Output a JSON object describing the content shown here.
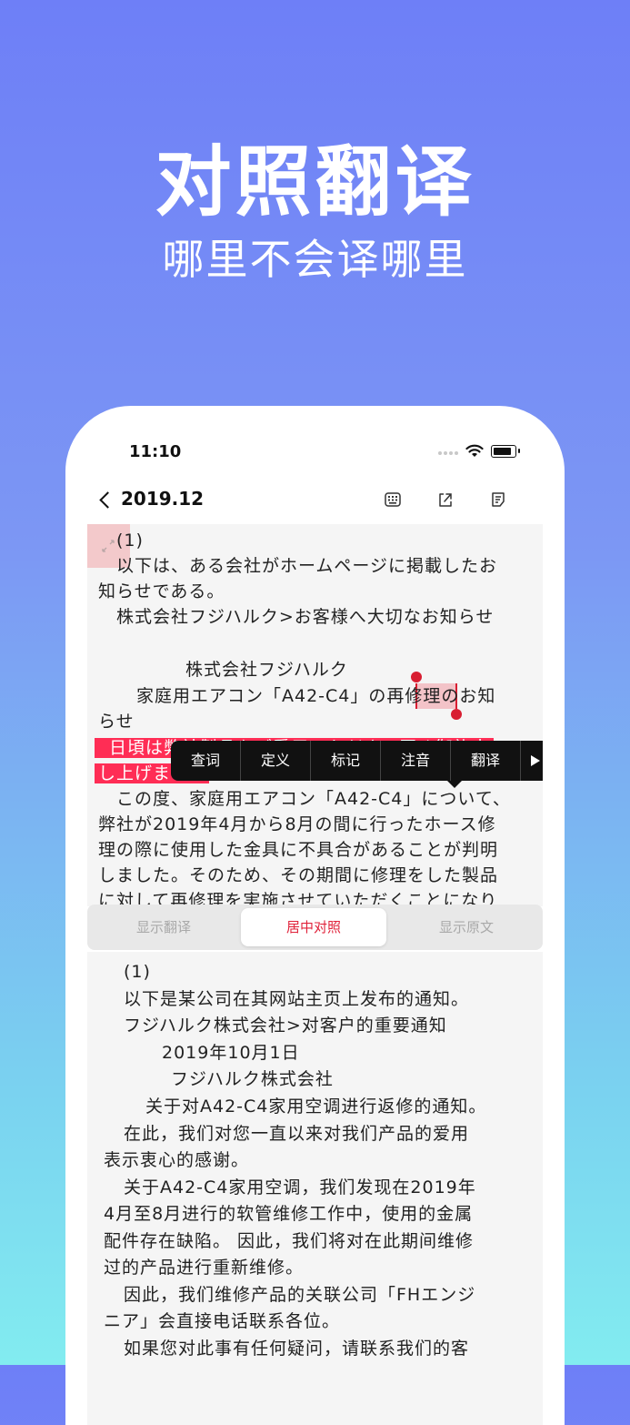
{
  "hero": {
    "title": "对照翻译",
    "subtitle": "哪里不会译哪里"
  },
  "status": {
    "time": "11:10"
  },
  "nav": {
    "back_label": "2019.12",
    "icons": [
      "keyboard-icon",
      "share-icon",
      "note-icon"
    ]
  },
  "original": {
    "lines": [
      "(1)",
      "以下は、ある会社がホームページに掲載したお",
      "知らせである。",
      "株式会社フジハルク>お客様へ大切なお知らせ",
      "株式会社フジハルク",
      "家庭用エアコン「A42-C4」の再修理のお知",
      "らせ",
      "日頃は弊社製品をご愛用いただき、厚く御礼申",
      "し上げます。",
      "この度、家庭用エアコン「A42-C4」について、",
      "弊社が2019年4月から8月の間に行ったホース修",
      "理の際に使用した金具に不具合があることが判明",
      "しました。そのため、その期間に修理をした製品",
      "に対して再修理を実施させていただくことになり"
    ]
  },
  "popup_menu": {
    "items": [
      "查词",
      "定义",
      "标记",
      "注音",
      "翻译"
    ]
  },
  "segments": {
    "options": [
      "显示翻译",
      "居中对照",
      "显示原文"
    ],
    "selected": "居中对照"
  },
  "translation": {
    "lines": [
      "(1)",
      "以下是某公司在其网站主页上发布的通知。",
      "フジハルク株式会社>对客户的重要通知",
      "2019年10月1日",
      "フジハルク株式会社",
      "关于对A42-C4家用空调进行返修的通知。",
      "在此，我们对您一直以来对我们产品的爱用",
      "表示衷心的感谢。",
      "关于A42-C4家用空调，我们发现在2019年",
      "4月至8月进行的软管维修工作中，使用的金属",
      "配件存在缺陷。 因此，我们将对在此期间维修",
      "过的产品进行重新维修。",
      "因此，我们维修产品的关联公司「FHエンジ",
      "ニア」会直接电话联系各位。",
      "如果您对此事有任何疑问，请联系我们的客"
    ]
  },
  "colors": {
    "accent": "#e0223a",
    "highlight": "#ff2d55",
    "hero_top": "#6e7ff7",
    "hero_bottom": "#82ecf0"
  }
}
